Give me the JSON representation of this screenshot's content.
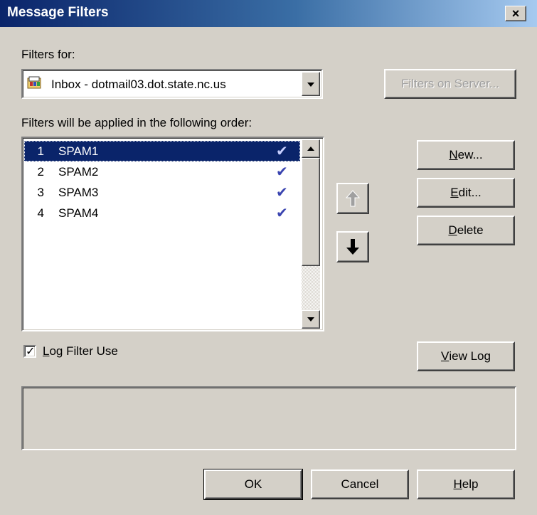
{
  "window": {
    "title": "Message Filters",
    "close_glyph": "×"
  },
  "filters_for": {
    "label": "Filters for:",
    "selected": "Inbox - dotmail03.dot.state.nc.us",
    "icon": "inbox-icon"
  },
  "filters_on_server_button": "Filters on Server...",
  "order_label": "Filters will be applied in the following order:",
  "filters": [
    {
      "num": "1",
      "name": "SPAM1",
      "enabled": true,
      "selected": true
    },
    {
      "num": "2",
      "name": "SPAM2",
      "enabled": true,
      "selected": false
    },
    {
      "num": "3",
      "name": "SPAM3",
      "enabled": true,
      "selected": false
    },
    {
      "num": "4",
      "name": "SPAM4",
      "enabled": true,
      "selected": false
    }
  ],
  "check_glyph": "✔",
  "buttons": {
    "new": {
      "accel": "N",
      "rest": "ew..."
    },
    "edit": {
      "accel": "E",
      "rest": "dit..."
    },
    "delete": {
      "accel": "D",
      "rest": "elete"
    },
    "view_log": {
      "accel": "V",
      "rest": "iew Log"
    },
    "ok": "OK",
    "cancel": "Cancel",
    "help": {
      "accel": "H",
      "rest": "elp"
    }
  },
  "move_up_glyph": "🡅",
  "move_down_glyph": "🡇",
  "log_filter": {
    "accel": "L",
    "rest": "og Filter Use",
    "checked": true,
    "check_glyph": "✓"
  }
}
